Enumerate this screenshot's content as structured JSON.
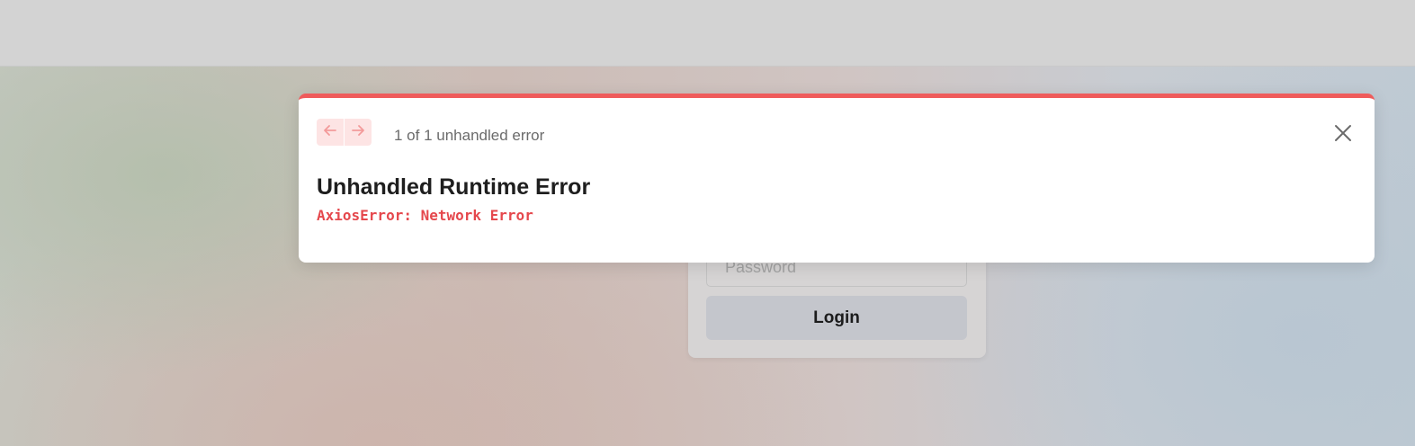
{
  "error_overlay": {
    "count_text": "1 of 1 unhandled error",
    "title": "Unhandled Runtime Error",
    "message": "AxiosError: Network Error",
    "icons": {
      "prev": "arrow-left-icon",
      "next": "arrow-right-icon",
      "close": "close-icon"
    },
    "accent_color": "#ef5b5b"
  },
  "login_form": {
    "password_placeholder": "Password",
    "login_label": "Login"
  }
}
